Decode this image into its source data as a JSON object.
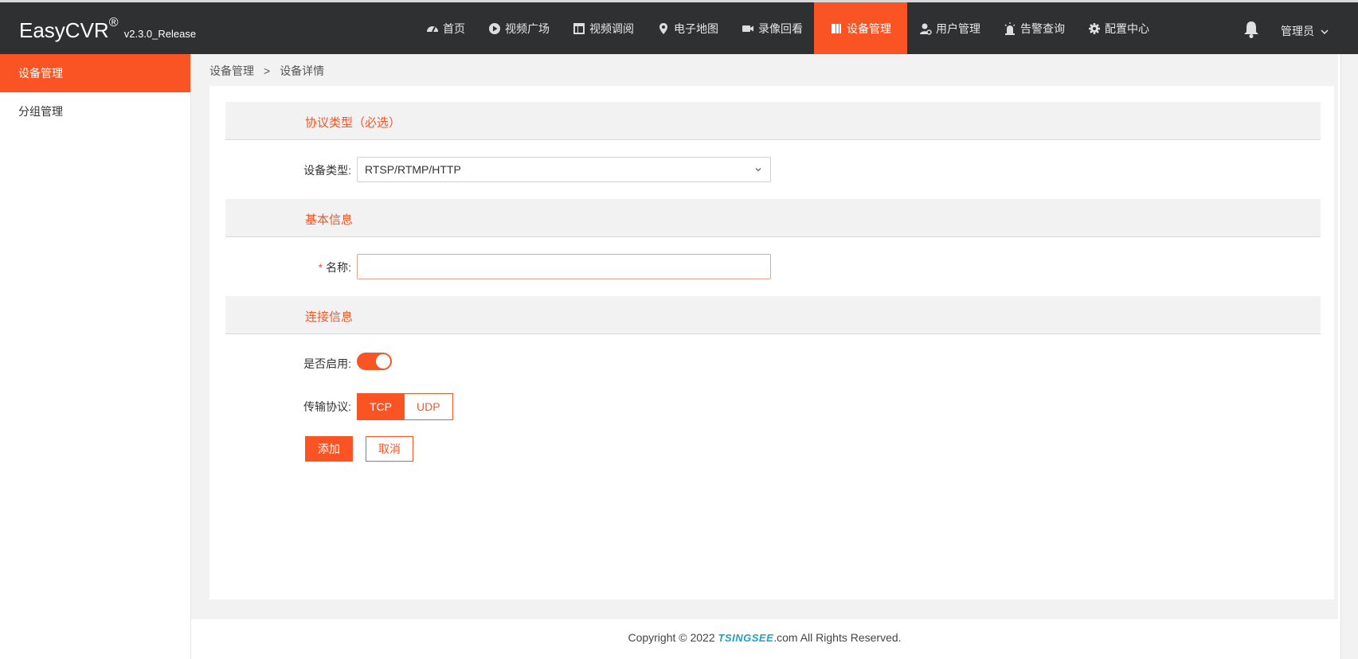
{
  "header": {
    "app_name": "EasyCVR",
    "registered": "®",
    "version": "v2.3.0_Release",
    "nav": [
      {
        "label": "首页",
        "icon": "dashboard-icon"
      },
      {
        "label": "视频广场",
        "icon": "play-circle-icon"
      },
      {
        "label": "视频调阅",
        "icon": "layout-icon"
      },
      {
        "label": "电子地图",
        "icon": "map-marker-icon"
      },
      {
        "label": "录像回看",
        "icon": "video-camera-icon"
      },
      {
        "label": "设备管理",
        "icon": "device-icon",
        "active": true
      },
      {
        "label": "用户管理",
        "icon": "user-gear-icon"
      },
      {
        "label": "告警查询",
        "icon": "alarm-icon"
      },
      {
        "label": "配置中心",
        "icon": "gear-icon"
      }
    ],
    "user_label": "管理员"
  },
  "sidebar": {
    "items": [
      {
        "label": "设备管理",
        "active": true
      },
      {
        "label": "分组管理",
        "active": false
      }
    ]
  },
  "breadcrumb": {
    "root": "设备管理",
    "separator": ">",
    "current": "设备详情"
  },
  "form": {
    "section_protocol": "协议类型（必选）",
    "device_type_label": "设备类型:",
    "device_type_value": "RTSP/RTMP/HTTP",
    "section_basic": "基本信息",
    "name_required_mark": "*",
    "name_label": "名称:",
    "name_value": "",
    "section_connection": "连接信息",
    "enable_label": "是否启用:",
    "enabled": true,
    "transport_label": "传输协议:",
    "transport_options": [
      "TCP",
      "UDP"
    ],
    "transport_selected": "TCP",
    "add_button": "添加",
    "cancel_button": "取消"
  },
  "footer": {
    "prefix": "Copyright © 2022 ",
    "brand": "TSINGSEE",
    "suffix": ".com All Rights Reserved."
  },
  "colors": {
    "accent": "#fa5425",
    "topbar": "#2f3031"
  }
}
